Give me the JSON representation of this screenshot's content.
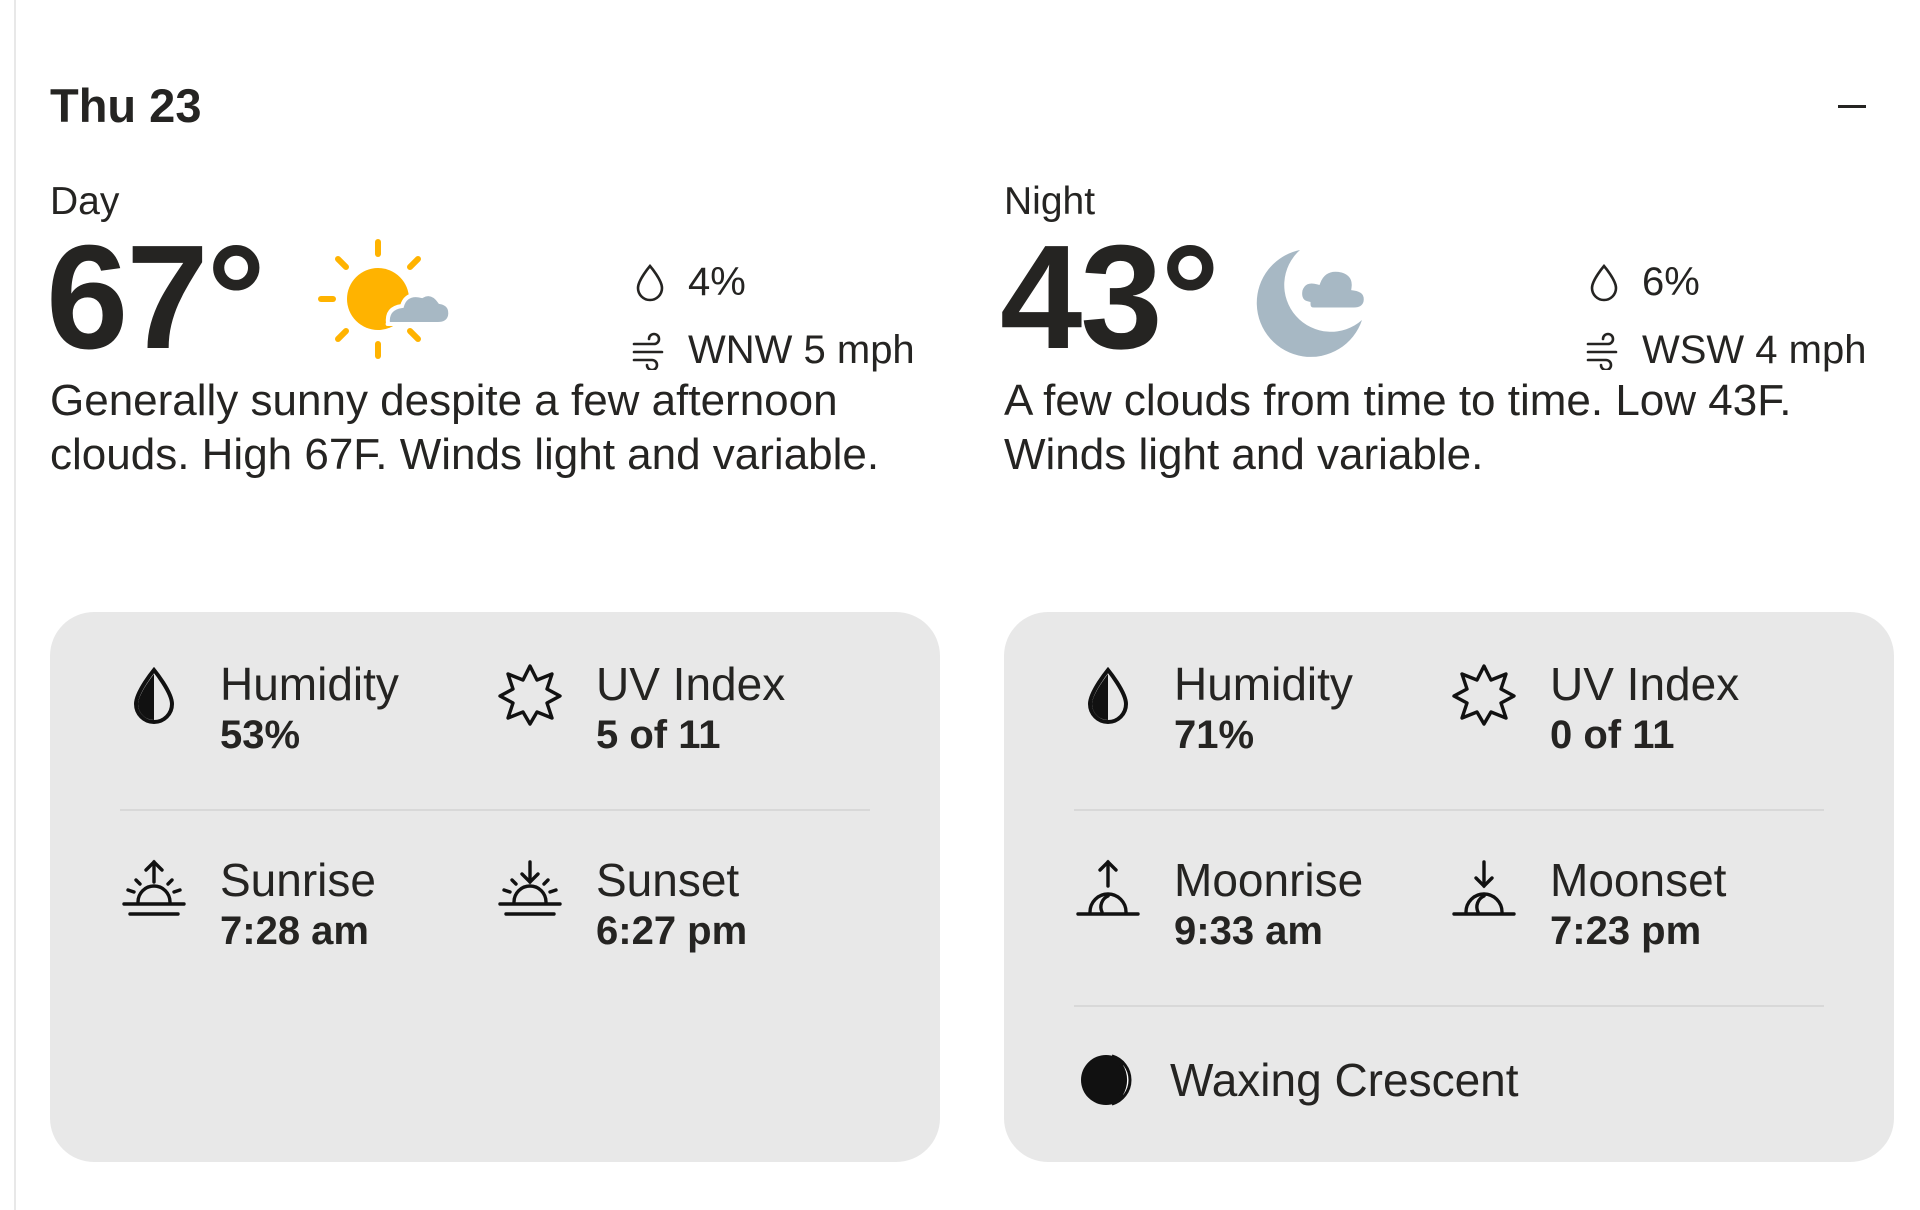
{
  "header": {
    "date": "Thu 23",
    "collapse_icon": "minus-icon"
  },
  "colors": {
    "sun": "#FFB300",
    "cloud": "#A7B8C4",
    "moon_cloud": "#A7B8C4",
    "card_bg": "#E8E8E8",
    "text": "#252422"
  },
  "day": {
    "label": "Day",
    "temperature": "67°",
    "condition_icon": "mostly-sunny-icon",
    "precip_icon": "raindrop-icon",
    "precip": "4%",
    "wind_icon": "wind-icon",
    "wind": "WNW 5 mph",
    "narrative": "Generally sunny despite a few afternoon clouds. High 67F. Winds light and variable.",
    "details": {
      "humidity_label": "Humidity",
      "humidity_value": "53%",
      "uv_label": "UV Index",
      "uv_value": "5 of 11",
      "rise_label": "Sunrise",
      "rise_value": "7:28 am",
      "set_label": "Sunset",
      "set_value": "6:27 pm"
    }
  },
  "night": {
    "label": "Night",
    "temperature": "43°",
    "condition_icon": "partly-cloudy-night-icon",
    "precip_icon": "raindrop-icon",
    "precip": "6%",
    "wind_icon": "wind-icon",
    "wind": "WSW 4 mph",
    "narrative": "A few clouds from time to time. Low 43F. Winds light and variable.",
    "details": {
      "humidity_label": "Humidity",
      "humidity_value": "71%",
      "uv_label": "UV Index",
      "uv_value": "0 of 11",
      "rise_label": "Moonrise",
      "rise_value": "9:33 am",
      "set_label": "Moonset",
      "set_value": "7:23 pm",
      "moon_phase": "Waxing Crescent"
    }
  }
}
